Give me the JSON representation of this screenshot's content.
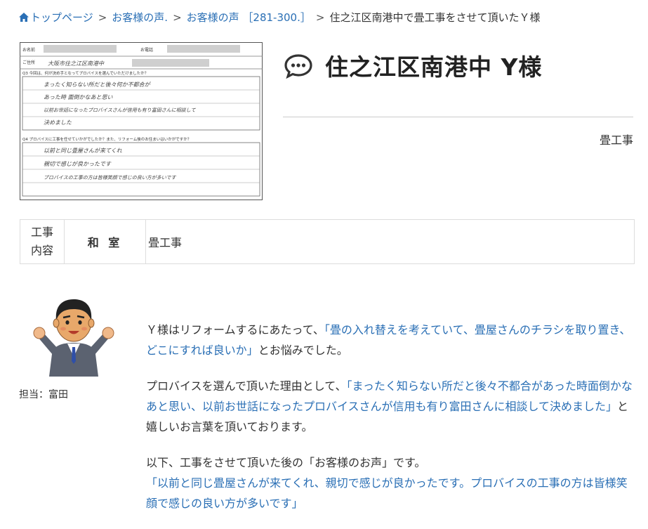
{
  "breadcrumb": {
    "home": "トップページ",
    "item1": "お客様の声.",
    "item2": "お客様の声 ［281-300.］",
    "current": "住之江区南港中で畳工事をさせて頂いたＹ様"
  },
  "title": "住之江区南港中 Y様",
  "category": "畳工事",
  "work_table": {
    "header_line1": "工事",
    "header_line2": "内容",
    "room": "和 室",
    "work": "畳工事"
  },
  "staff_label": "担当：富田",
  "paragraph1": {
    "pre": "Ｙ様はリフォームするにあたって、",
    "quote": "「畳の入れ替えを考えていて、畳屋さんのチラシを取り置き、どこにすれば良いか」",
    "post": "とお悩みでした。"
  },
  "paragraph2": {
    "pre": "プロバイスを選んで頂いた理由として、",
    "quote": "「まったく知らない所だと後々不都合があった時面倒かなあと思い、以前お世話になったプロバイスさんが信用も有り富田さんに相談して決めました」",
    "post": "と嬉しいお言葉を頂いております。"
  },
  "paragraph3": {
    "line1": "以下、工事をさせて頂いた後の「お客様のお声」です。",
    "quote": "「以前と同じ畳屋さんが来てくれ、親切で感じが良かったです。プロバイスの工事の方は皆様笑顔で感じの良い方が多いです」"
  },
  "scan_form": {
    "name_label": "お名前",
    "kana_label": "お電話",
    "address_label": "ご住所",
    "address_value": "大阪市住之江区南港中",
    "q3_label": "Q3 今回は、何が決め手となってプロバイスを選んでいただけましたか？",
    "q3_line1": "まったく知らない所だと後々何か不都合が",
    "q3_line2": "あった時 面倒かなあと思い",
    "q3_line3": "以前お世話になったプロバイスさんが信用も有り富田さんに相談して",
    "q3_line4": "決めました",
    "q4_label": "Q4 プロバイスに工事を任せていかがでしたか？また、リフォーム後のお住まいはいかがですか？",
    "q4_line1": "以前と同じ畳屋さんが来てくれ",
    "q4_line2": "親切で感じが良かったです",
    "q4_line3": "プロバイスの工事の方は皆様笑顔で感じの良い方が多いです"
  },
  "colors": {
    "link": "#2a6fb5",
    "text": "#333333",
    "border": "#dddddd"
  }
}
